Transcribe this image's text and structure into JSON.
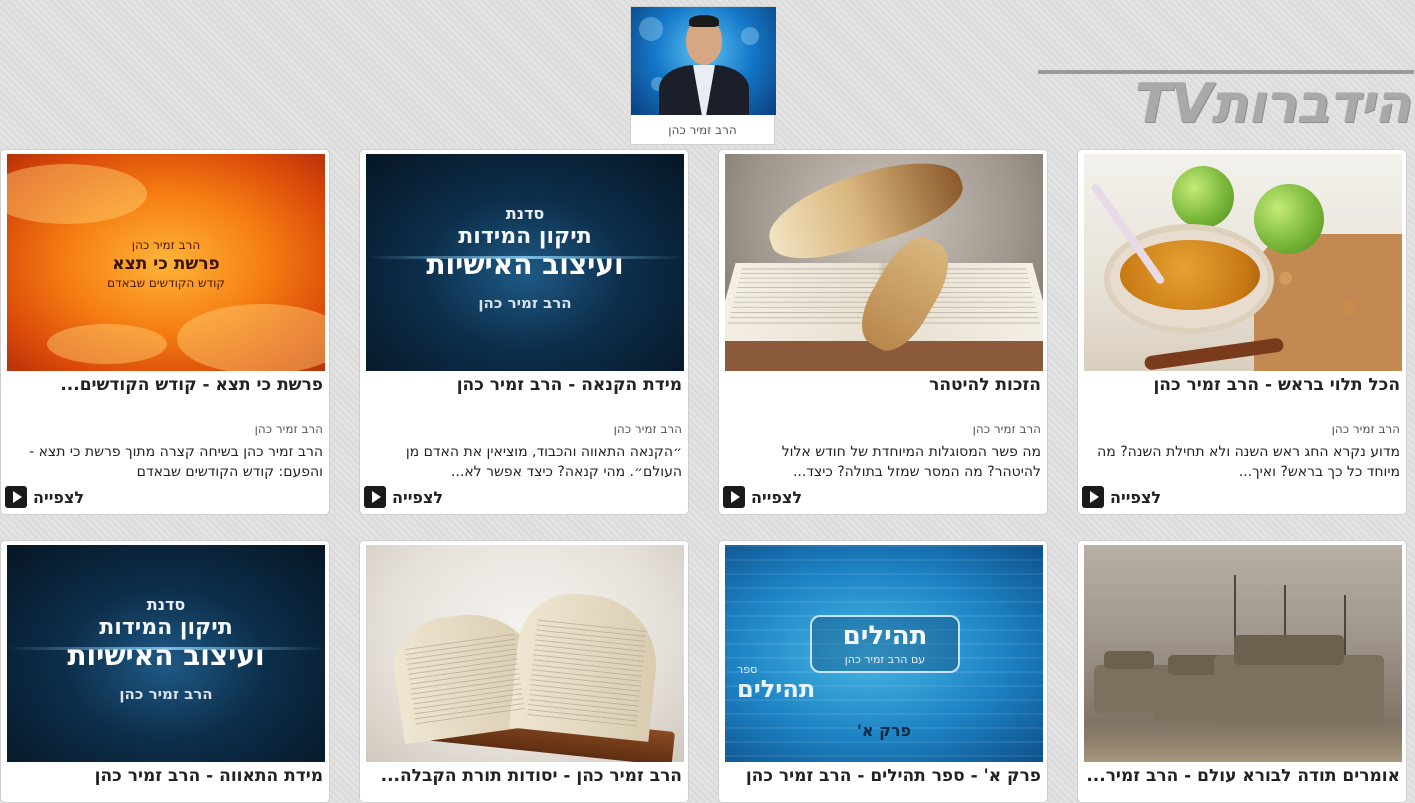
{
  "site": {
    "logo_text": "הידברותTV"
  },
  "author": {
    "name": "הרב זמיר כהן"
  },
  "watch_label": "לצפייה",
  "cards": [
    {
      "title": "הכל תלוי בראש - הרב זמיר כהן",
      "author": "הרב זמיר כהן",
      "description": "מדוע נקרא החג ראש השנה ולא תחילת השנה? מה מיוחד כל כך בראש? ואיך..."
    },
    {
      "title": "הזכות להיטהר",
      "author": "הרב זמיר כהן",
      "description": "מה פשר המסוגלות המיוחדת של חודש אלול להיטהר? מה המסר שמזל בתולה? כיצד..."
    },
    {
      "title": "מידת הקנאה - הרב זמיר כהן",
      "author": "הרב זמיר כהן",
      "description": "״הקנאה התאווה והכבוד, מוציאין את האדם מן העולם״. מהי קנאה? כיצד אפשר לא...",
      "thumb_text": [
        "סדנת",
        "תיקון המידות",
        "ועיצוב האישיות",
        "הרב זמיר כהן"
      ]
    },
    {
      "title": "פרשת כי תצא - קודש הקודשים...",
      "author": "הרב זמיר כהן",
      "description": "הרב זמיר כהן בשיחה קצרה מתוך פרשת כי תצא - והפעם: קודש הקודשים שבאדם",
      "thumb_text": [
        "הרב זמיר כהן",
        "פרשת כי תצא",
        "קודש הקודשים שבאדם"
      ]
    },
    {
      "title": "אומרים תודה לבורא עולם - הרב זמיר..."
    },
    {
      "title": "פרק א' - ספר תהילים - הרב זמיר כהן",
      "thumb_text": [
        "תהילים",
        "עם הרב זמיר כהן",
        "ספר",
        "תהילים",
        "פרק א'"
      ]
    },
    {
      "title": "הרב זמיר כהן - יסודות תורת הקבלה..."
    },
    {
      "title": "מידת התאווה - הרב זמיר כהן",
      "thumb_text": [
        "סדנת",
        "תיקון המידות",
        "ועיצוב האישיות",
        "הרב זמיר כהן"
      ]
    }
  ]
}
